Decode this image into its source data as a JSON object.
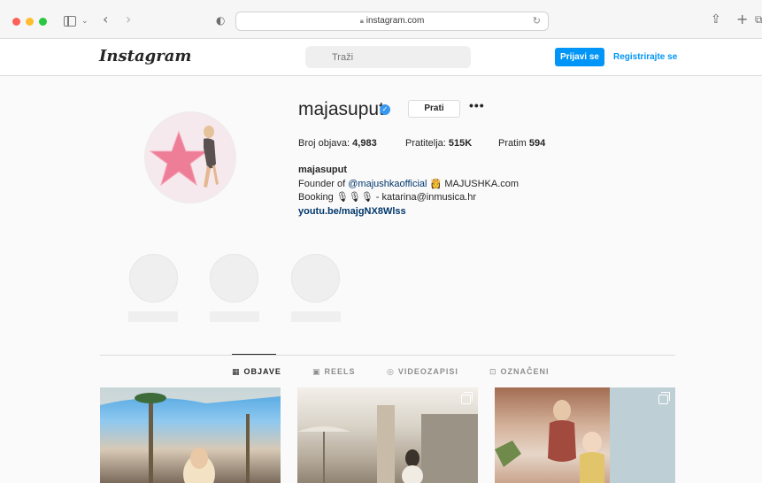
{
  "browser": {
    "url": "instagram.com",
    "lock_icon": "lock-icon"
  },
  "header": {
    "logo": "Instagram",
    "search_placeholder": "Traži",
    "login_label": "Prijavi se",
    "register_label": "Registrirajte se"
  },
  "profile": {
    "username": "majasuput",
    "follow_label": "Prati",
    "more_label": "•••",
    "stats": {
      "posts_label": "Broj objava:",
      "posts_value": "4,983",
      "followers_label": "Pratitelja:",
      "followers_value": "515K",
      "following_label": "Pratim",
      "following_value": "594"
    },
    "bio": {
      "name": "majasuput",
      "line1_prefix": "Founder of ",
      "line1_mention": "@majushkaofficial",
      "line1_emoji": "👸",
      "line1_suffix": " MAJUSHKA.com",
      "line2": "Booking 🎙🎙🎙 - katarina@inmusica.hr",
      "link": "youtu.be/majgNX8Wlss"
    }
  },
  "tabs": [
    {
      "label": "OBJAVE",
      "icon": "grid-icon",
      "active": true
    },
    {
      "label": "REELS",
      "icon": "reels-icon",
      "active": false
    },
    {
      "label": "VIDEOZAPISI",
      "icon": "video-icon",
      "active": false
    },
    {
      "label": "OZNAČENI",
      "icon": "tagged-icon",
      "active": false
    }
  ],
  "colors": {
    "accent": "#0095f6",
    "link": "#00376b",
    "verified": "#3897f0"
  }
}
